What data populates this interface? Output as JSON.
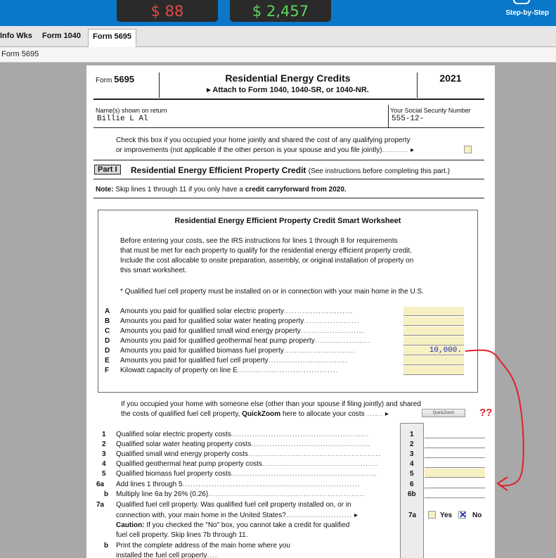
{
  "topbar": {
    "federal_refund": "$ 88",
    "state_refund": "$ 2,457",
    "step_by_step": "Step-by-Step"
  },
  "tabs": [
    {
      "label": "Info Wks"
    },
    {
      "label": "Form 1040"
    },
    {
      "label": "Form 5695",
      "active": true
    }
  ],
  "breadcrumb": "Form 5695",
  "form": {
    "form_prefix": "Form",
    "form_number": "5695",
    "title": "Residential Energy Credits",
    "subtitle": "Attach to Form 1040, 1040-SR, or 1040-NR.",
    "year": "2021",
    "name_label": "Name(s) shown on return",
    "name_value": "Billie L Al",
    "ssn_label": "Your Social Security Number",
    "ssn_value": "555-12-",
    "jointly_line1": "Check this box if you occupied your home jointly and shared the cost of any qualifying property",
    "jointly_line2": "or improvements (not applicable if the other person is your spouse and you file jointly)",
    "part_label": "Part I",
    "part_title": "Residential Energy Efficient Property Credit",
    "part_note": "(See instructions before completing this part.)",
    "note_label": "Note:",
    "note_text": "Skip lines 1 through 11 if you only have a",
    "note_bold": "credit carryforward from 2020."
  },
  "worksheet": {
    "title": "Residential Energy Efficient Property Credit Smart Worksheet",
    "intro": [
      "Before entering your costs, see the IRS instructions for lines 1 through 8 for requirements",
      "that must be met for each property to qualify for the residential energy efficient property credit.",
      "Include the cost allocable to onsite preparation, assembly, or original installation of property on",
      "this smart worksheet."
    ],
    "fuel_note": "* Qualified fuel cell property must be installed on or in connection with your main home in the U.S.",
    "lines": [
      {
        "letter": "A",
        "text": "Amounts you paid for qualified solar electric property",
        "value": ""
      },
      {
        "letter": "B",
        "text": "Amounts you paid for qualified solar water heating property",
        "value": ""
      },
      {
        "letter": "C",
        "text": "Amounts you paid for qualified small wind energy property",
        "value": ""
      },
      {
        "letter": "D",
        "text": "Amounts you paid for qualified geothermal heat pump property",
        "value": ""
      },
      {
        "letter": "D",
        "text": "Amounts you paid for qualified biomass fuel property",
        "value": "10,000."
      },
      {
        "letter": "E",
        "text": "Amounts you paid for qualified fuel cell property",
        "value": ""
      },
      {
        "letter": "F",
        "text": "Kilowatt capacity of property on line E",
        "value": ""
      }
    ]
  },
  "shared": {
    "line1": "If you occupied your home with someone else (other than your spouse if filing jointly) and shared",
    "line2_pre": "the costs of qualified fuel cell property,",
    "line2_bold": "QuickZoom",
    "line2_post": "here to allocate your costs",
    "quickzoom_label": "QuickZoom",
    "annotation": "??"
  },
  "lines": [
    {
      "num": "1",
      "text": "Qualified solar electric property costs",
      "box": "1"
    },
    {
      "num": "2",
      "text": "Qualified solar water heating property costs",
      "box": "2"
    },
    {
      "num": "3",
      "text": "Qualified small wind energy property costs",
      "box": "3"
    },
    {
      "num": "4",
      "text": "Qualified geothermal heat pump property costs",
      "box": "4"
    },
    {
      "num": "5",
      "text": "Qualified biomass fuel property costs",
      "box": "5"
    },
    {
      "num": "6a",
      "text": "Add lines 1 through 5",
      "box": "6"
    },
    {
      "num": "b",
      "text": "Multiply line 6a by 26% (0.26)",
      "box": "6b"
    }
  ],
  "line7": {
    "num": "7a",
    "text1": "Qualified fuel cell property. Was qualified fuel cell property installed on, or in",
    "text2": "connection with, your main home in the United States?",
    "caution_label": "Caution:",
    "caution_text": "If you checked the \"No\" box, you cannot take a credit for qualified",
    "caution_text2": "fuel cell property. Skip lines 7b through 11.",
    "box": "7a",
    "yes": "Yes",
    "no": "No",
    "b_num": "b",
    "b_text1": "Print the complete address of the main home where you",
    "b_text2": "installed the fuel cell property"
  },
  "colors": {
    "header_blue": "#0b77c8",
    "field_yellow": "#f7f0c2",
    "annotation_red": "#e0202a"
  }
}
